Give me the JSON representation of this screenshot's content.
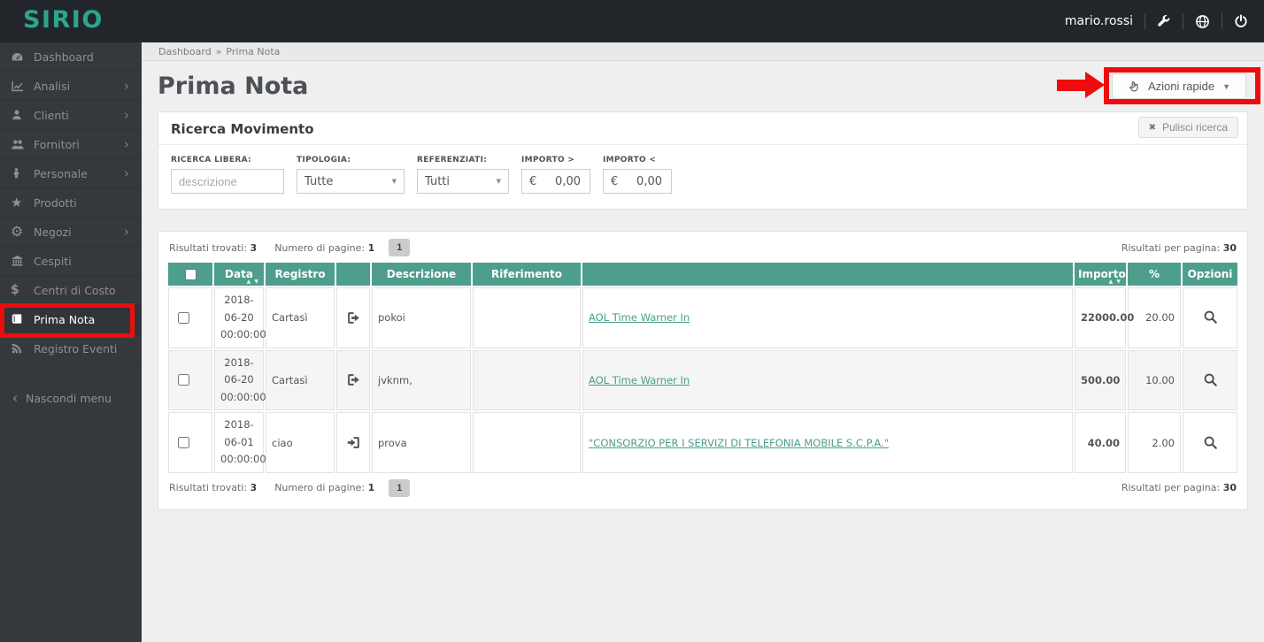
{
  "topbar": {
    "logo": "SIRIO",
    "username": "mario.rossi",
    "icons": [
      "wrench-icon",
      "globe-icon",
      "power-icon"
    ]
  },
  "sidebar": {
    "items": [
      {
        "label": "Dashboard",
        "icon": "dashboard",
        "has_submenu": false,
        "active": false
      },
      {
        "label": "Analisi",
        "icon": "line-chart",
        "has_submenu": true,
        "active": false
      },
      {
        "label": "Clienti",
        "icon": "user",
        "has_submenu": true,
        "active": false
      },
      {
        "label": "Fornitori",
        "icon": "users",
        "has_submenu": true,
        "active": false
      },
      {
        "label": "Personale",
        "icon": "person",
        "has_submenu": true,
        "active": false
      },
      {
        "label": "Prodotti",
        "icon": "star",
        "has_submenu": false,
        "active": false
      },
      {
        "label": "Negozi",
        "icon": "gear",
        "has_submenu": true,
        "active": false
      },
      {
        "label": "Cespiti",
        "icon": "bank",
        "has_submenu": false,
        "active": false
      },
      {
        "label": "Centri di Costo",
        "icon": "dollar",
        "has_submenu": false,
        "active": false
      },
      {
        "label": "Prima Nota",
        "icon": "book",
        "has_submenu": false,
        "active": true
      },
      {
        "label": "Registro Eventi",
        "icon": "rss",
        "has_submenu": false,
        "active": false
      }
    ],
    "collapse_label": "Nascondi menu"
  },
  "breadcrumb": {
    "home": "Dashboard",
    "separator": "»",
    "current": "Prima Nota"
  },
  "page": {
    "title": "Prima Nota",
    "quick_actions_label": "Azioni rapide"
  },
  "search_panel": {
    "title": "Ricerca Movimento",
    "clear_label": "Pulisci ricerca",
    "fields": {
      "ricerca_libera": {
        "label": "RICERCA LIBERA:",
        "placeholder": "descrizione"
      },
      "tipologia": {
        "label": "TIPOLOGIA:",
        "value": "Tutte"
      },
      "referenziati": {
        "label": "REFERENZIATI:",
        "value": "Tutti"
      },
      "importo_gt": {
        "label": "IMPORTO >",
        "prefix": "€",
        "value": "0,00"
      },
      "importo_lt": {
        "label": "IMPORTO <",
        "prefix": "€",
        "value": "0,00"
      }
    }
  },
  "results": {
    "found_label": "Risultati trovati:",
    "found_value": "3",
    "pages_label": "Numero di pagine:",
    "pages_value": "1",
    "current_page": "1",
    "per_page_label": "Risultati per pagina:",
    "per_page_value": "30"
  },
  "table": {
    "columns": [
      {
        "key": "check",
        "label": "",
        "type": "checkbox"
      },
      {
        "key": "data",
        "label": "Data",
        "sortable": true
      },
      {
        "key": "registro",
        "label": "Registro"
      },
      {
        "key": "direction",
        "label": "",
        "type": "icon"
      },
      {
        "key": "descrizione",
        "label": "Descrizione"
      },
      {
        "key": "riferimento",
        "label": "Riferimento"
      },
      {
        "key": "riferimento_link",
        "label": "",
        "type": "link"
      },
      {
        "key": "importo",
        "label": "Importo",
        "sortable": true
      },
      {
        "key": "percent",
        "label": "%"
      },
      {
        "key": "opzioni",
        "label": "Opzioni",
        "type": "options"
      }
    ],
    "rows": [
      {
        "data": "2018-06-20 00:00:00",
        "registro": "Cartasì",
        "direction": "out",
        "descrizione": "pokoi",
        "riferimento": "",
        "riferimento_link": "AOL Time Warner In",
        "importo": "22000.00",
        "percent": "20.00"
      },
      {
        "data": "2018-06-20 00:00:00",
        "registro": "Cartasì",
        "direction": "out",
        "descrizione": "jvknm,",
        "riferimento": "",
        "riferimento_link": "AOL Time Warner In",
        "importo": "500.00",
        "percent": "10.00"
      },
      {
        "data": "2018-06-01 00:00:00",
        "registro": "ciao",
        "direction": "in",
        "descrizione": "prova",
        "riferimento": "",
        "riferimento_link": "\"CONSORZIO PER I SERVIZI DI TELEFONIA MOBILE S.C.P.A.\"",
        "importo": "40.00",
        "percent": "2.00"
      }
    ]
  },
  "colors": {
    "accent_teal": "#4d9e8c",
    "logo_teal": "#2da58e",
    "annotation_red": "#ee0c0c",
    "amount_green": "#2e8b2e",
    "topbar_dark": "#22262a",
    "sidebar_dark": "#35393d"
  }
}
